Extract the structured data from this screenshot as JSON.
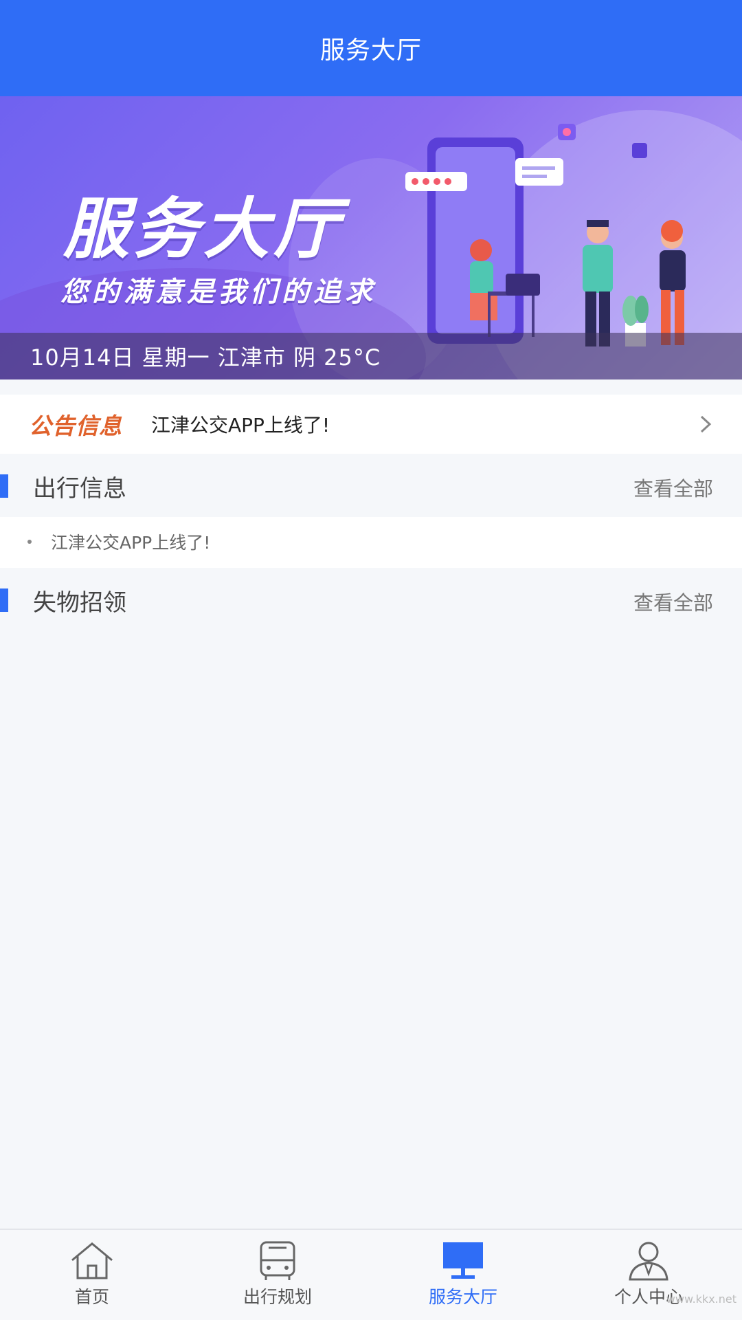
{
  "header": {
    "title": "服务大厅"
  },
  "banner": {
    "title": "服务大厅",
    "subtitle": "您的满意是我们的追求",
    "weather": "10月14日 星期一 江津市 阴 25°C"
  },
  "notice": {
    "tag": "公告信息",
    "text": "江津公交APP上线了!"
  },
  "sections": {
    "travel": {
      "title": "出行信息",
      "more": "查看全部",
      "items": [
        {
          "text": "江津公交APP上线了!"
        }
      ]
    },
    "lost_found": {
      "title": "失物招领",
      "more": "查看全部"
    }
  },
  "tabbar": {
    "items": [
      {
        "label": "首页",
        "icon": "home-icon",
        "active": false
      },
      {
        "label": "出行规划",
        "icon": "bus-icon",
        "active": false
      },
      {
        "label": "服务大厅",
        "icon": "monitor-icon",
        "active": true
      },
      {
        "label": "个人中心",
        "icon": "user-icon",
        "active": false
      }
    ]
  },
  "watermark": "www.kkx.net",
  "colors": {
    "primary": "#2f6df6",
    "notice_tag": "#e0622c",
    "background": "#f5f7fa"
  }
}
